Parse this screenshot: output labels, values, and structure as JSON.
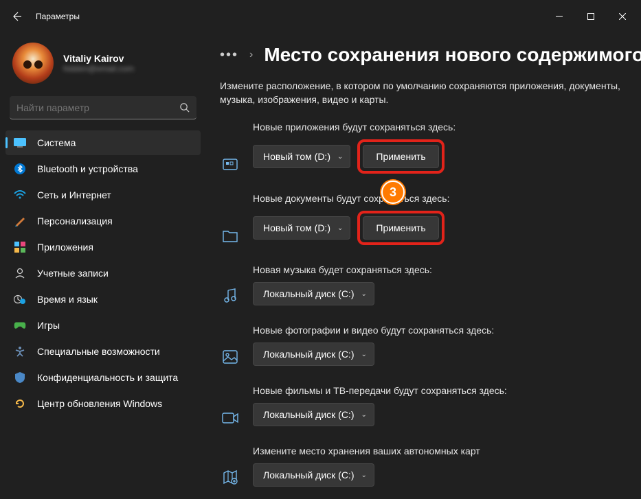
{
  "window": {
    "title": "Параметры"
  },
  "profile": {
    "name": "Vitaliy Kairov",
    "email": "hidden@email.com"
  },
  "search": {
    "placeholder": "Найти параметр"
  },
  "nav": {
    "items": [
      {
        "label": "Система"
      },
      {
        "label": "Bluetooth и устройства"
      },
      {
        "label": "Сеть и Интернет"
      },
      {
        "label": "Персонализация"
      },
      {
        "label": "Приложения"
      },
      {
        "label": "Учетные записи"
      },
      {
        "label": "Время и язык"
      },
      {
        "label": "Игры"
      },
      {
        "label": "Специальные возможности"
      },
      {
        "label": "Конфиденциальность и защита"
      },
      {
        "label": "Центр обновления Windows"
      }
    ]
  },
  "page": {
    "title": "Место сохранения нового содержимого",
    "description": "Измените расположение, в котором по умолчанию сохраняются приложения, документы, музыка, изображения, видео и карты."
  },
  "sections": {
    "apps": {
      "label": "Новые приложения будут сохраняться здесь:",
      "value": "Новый том (D:)",
      "apply": "Применить"
    },
    "docs": {
      "label": "Новые документы будут сохраняться здесь:",
      "value": "Новый том (D:)",
      "apply": "Применить"
    },
    "music": {
      "label": "Новая музыка будет сохраняться здесь:",
      "value": "Локальный диск (C:)"
    },
    "photos": {
      "label": "Новые фотографии и видео будут сохраняться здесь:",
      "value": "Локальный диск (C:)"
    },
    "movies": {
      "label": "Новые фильмы и ТВ-передачи будут сохраняться здесь:",
      "value": "Локальный диск (C:)"
    },
    "maps": {
      "label": "Измените место хранения ваших автономных карт",
      "value": "Локальный диск (C:)"
    }
  },
  "annotation": {
    "step": "3"
  }
}
